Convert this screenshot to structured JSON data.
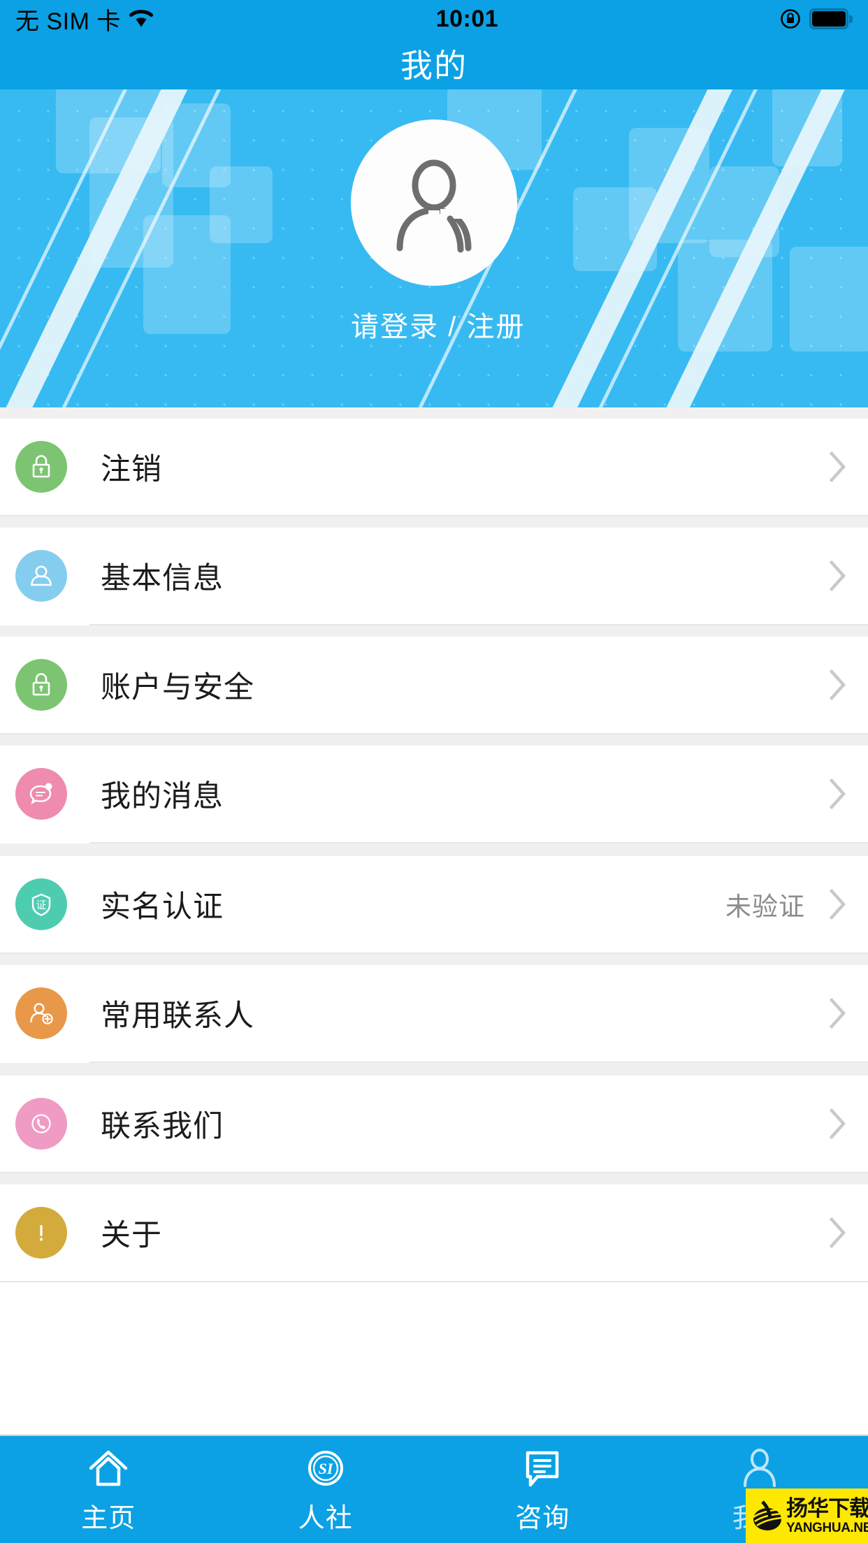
{
  "colors": {
    "header_blue": "#0BA1E4",
    "banner_blue": "#37BAF2",
    "page_bg": "#F0F0F0",
    "row_bg": "#FFFFFF",
    "label_text": "#1B1B1B",
    "value_text": "#8C8C8C",
    "chevron": "#C9C9C9",
    "watermark_bg": "#FFE800"
  },
  "statusbar": {
    "carrier": "无 SIM 卡",
    "wifi_icon": "wifi-icon",
    "time": "10:01",
    "rotation_lock_icon": "rotation-lock-icon",
    "battery_icon": "battery-full-icon"
  },
  "header": {
    "title": "我的"
  },
  "profile": {
    "avatar_icon": "user-avatar-placeholder-icon",
    "login_label": "请登录 / 注册"
  },
  "menu_groups": [
    {
      "items": [
        {
          "label": "注销",
          "icon": "lock-icon",
          "icon_bg": "#7CC472",
          "value": "",
          "chevron": true
        },
        {
          "label": "基本信息",
          "icon": "user-icon",
          "icon_bg": "#85CDEE",
          "value": "",
          "chevron": true
        },
        {
          "label": "账户与安全",
          "icon": "lock-icon",
          "icon_bg": "#7CC472",
          "value": "",
          "chevron": true
        },
        {
          "label": "我的消息",
          "icon": "message-bubble-icon",
          "icon_bg": "#EF8BAE",
          "value": "",
          "chevron": true
        }
      ]
    },
    {
      "items": [
        {
          "label": "实名认证",
          "icon": "shield-verify-icon",
          "icon_bg": "#4ECCB0",
          "value": "未验证",
          "chevron": true
        },
        {
          "label": "常用联系人",
          "icon": "add-contact-icon",
          "icon_bg": "#E89848",
          "value": "",
          "chevron": true
        }
      ]
    },
    {
      "items": [
        {
          "label": "联系我们",
          "icon": "phone-icon",
          "icon_bg": "#F09BC4",
          "value": "",
          "chevron": true
        },
        {
          "label": "关于",
          "icon": "exclamation-icon",
          "icon_bg": "#D3AB3D",
          "value": "",
          "chevron": true
        }
      ]
    }
  ],
  "tabbar": {
    "tabs": [
      {
        "label": "主页",
        "icon": "home-icon",
        "active": false
      },
      {
        "label": "人社",
        "icon": "si-badge-icon",
        "active": false
      },
      {
        "label": "咨询",
        "icon": "chat-lines-icon",
        "active": false
      },
      {
        "label": "我的",
        "icon": "person-icon",
        "active": true
      }
    ]
  },
  "watermark": {
    "logo_icon": "yanghua-globe-logo-icon",
    "cn": "扬华下载",
    "en": "YANGHUA.NET"
  }
}
